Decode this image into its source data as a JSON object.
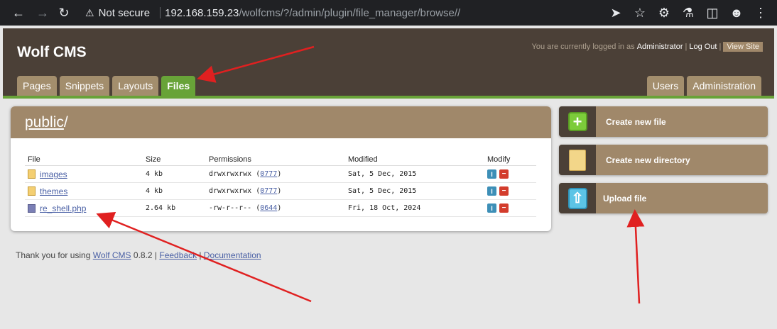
{
  "browser": {
    "security_label": "Not secure",
    "url_host": "192.168.159.23",
    "url_path": "/wolfcms/?/admin/plugin/file_manager/browse//"
  },
  "header": {
    "logo": "Wolf CMS",
    "login_prefix": "You are currently logged in as",
    "user": "Administrator",
    "pipe": "|",
    "logout": "Log Out",
    "view_site": "View Site"
  },
  "tabs_left": [
    "Pages",
    "Snippets",
    "Layouts",
    "Files"
  ],
  "tabs_right": [
    "Users",
    "Administration"
  ],
  "active_tab": "Files",
  "panel": {
    "crumb": "public",
    "crumb_sep": "/"
  },
  "table": {
    "headers": [
      "File",
      "Size",
      "Permissions",
      "Modified",
      "Modify"
    ],
    "rows": [
      {
        "name": "images",
        "size": "4 kb",
        "perm": "drwxrwxrwx",
        "octal": "0777",
        "modified": "Sat, 5 Dec, 2015",
        "type": "folder"
      },
      {
        "name": "themes",
        "size": "4 kb",
        "perm": "drwxrwxrwx",
        "octal": "0777",
        "modified": "Sat, 5 Dec, 2015",
        "type": "folder"
      },
      {
        "name": "re_shell.php",
        "size": "2.64 kb",
        "perm": "-rw-r--r--",
        "octal": "0644",
        "modified": "Fri, 18 Oct, 2024",
        "type": "file"
      }
    ]
  },
  "actions": {
    "create_file": "Create new file",
    "create_dir": "Create new directory",
    "upload": "Upload file"
  },
  "footer": {
    "prefix": "Thank you for using",
    "link_cms": "Wolf CMS",
    "version": "0.8.2 |",
    "feedback": "Feedback",
    "sep": "|",
    "docs": "Documentation"
  },
  "colors": {
    "header_bg": "#4b4037",
    "tab_bg": "#a38e6d",
    "tab_active": "#68a338",
    "panel_head": "#a0886a",
    "annotation_arrow": "#e02020"
  }
}
